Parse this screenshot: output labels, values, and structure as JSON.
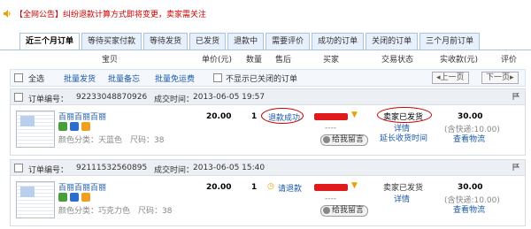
{
  "notice": {
    "text": "【全网公告】纠纷退款计算方式即将变更，卖家需关注"
  },
  "tabs": [
    "近三个月订单",
    "等待买家付款",
    "等待发货",
    "已发货",
    "退款中",
    "需要评价",
    "成功的订单",
    "关闭的订单",
    "三个月前订单"
  ],
  "columns": [
    "宝贝",
    "单价(元)",
    "数量",
    "售后",
    "买家",
    "交易状态",
    "实收款(元)",
    "评价"
  ],
  "toolbar": {
    "select_all": "全选",
    "bulk_ship": "批量发货",
    "bulk_note": "批量备忘",
    "bulk_free_shipping": "批量免运费",
    "hide_closed": "不显示已关闭的订单",
    "prev": "上一页",
    "next": "下一页"
  },
  "orders": [
    {
      "order_label": "订单编号：",
      "order_id": "92233048870926",
      "time_label": "成交时间：",
      "time": "2013-06-05 19:57",
      "product": "百丽百丽百丽",
      "spec": "颜色分类：天蓝色　尺码：38",
      "price": "20.00",
      "qty": "1",
      "after_sale": "退款成功",
      "buyer_dash": "----",
      "message": "给我留言",
      "status": "卖家已发货",
      "status_links": [
        "详情",
        "延长收货时间"
      ],
      "amount": "30.00",
      "amount_note": "(含快递:10.00)",
      "amount_link": "查看物流"
    },
    {
      "order_label": "订单编号：",
      "order_id": "92111532560895",
      "time_label": "成交时间：",
      "time": "2013-06-05 15:40",
      "product": "百丽百丽百丽",
      "spec": "颜色分类：巧克力色　尺码：38",
      "price": "20.00",
      "qty": "1",
      "after_sale": "请退款",
      "buyer_dash": "----",
      "message": "给我留言",
      "status": "卖家已发货",
      "status_links": [
        "详情"
      ],
      "amount": "30.00",
      "amount_note": "(含快递:10.00)",
      "amount_link": "查看物流"
    }
  ],
  "colors": {
    "accent": "#1a57a8",
    "alert": "#cc0000",
    "redacted": "#e11b1b"
  }
}
